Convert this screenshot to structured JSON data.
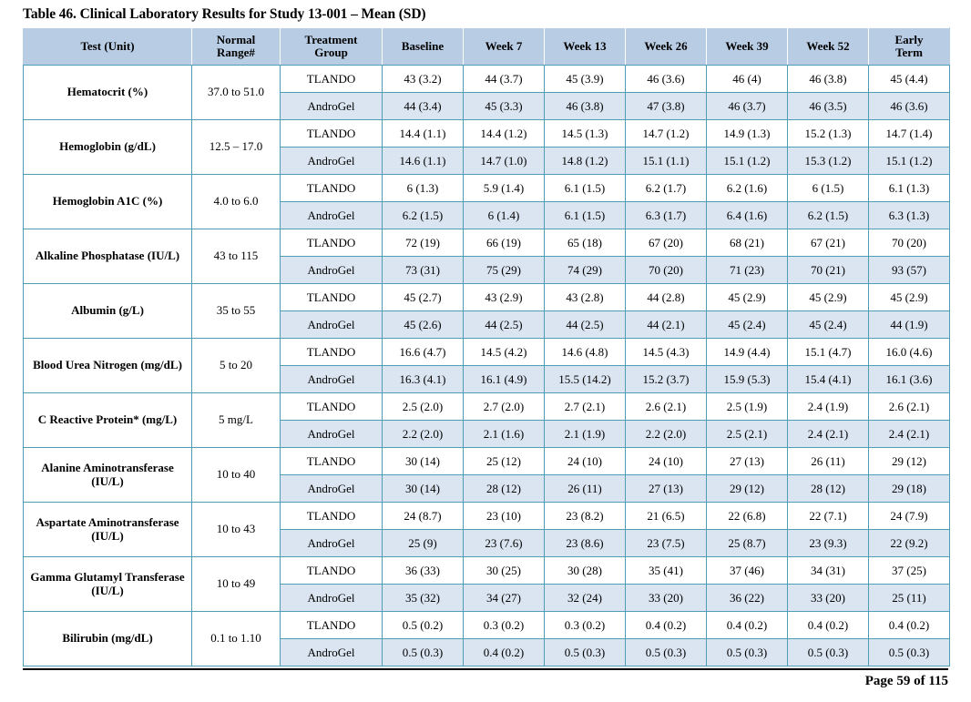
{
  "document": {
    "title": "Table 46.  Clinical Laboratory Results for Study 13-001 – Mean (SD)",
    "page_number": "Page 59 of 115"
  },
  "table": {
    "columns": [
      "Test (Unit)",
      "Normal Range#",
      "Treatment Group",
      "Baseline",
      "Week 7",
      "Week 13",
      "Week 26",
      "Week 39",
      "Week 52",
      "Early Term"
    ],
    "column_lines": [
      [
        "Test (Unit)"
      ],
      [
        "Normal",
        "Range#"
      ],
      [
        "Treatment",
        "Group"
      ],
      [
        "Baseline"
      ],
      [
        "Week 7"
      ],
      [
        "Week 13"
      ],
      [
        "Week 26"
      ],
      [
        "Week 39"
      ],
      [
        "Week 52"
      ],
      [
        "Early",
        "Term"
      ]
    ],
    "rows": [
      {
        "test": "Hematocrit (%)",
        "range": "37.0 to 51.0",
        "groups": [
          {
            "name": "TLANDO",
            "values": [
              "43 (3.2)",
              "44 (3.7)",
              "45 (3.9)",
              "46 (3.6)",
              "46 (4)",
              "46 (3.8)",
              "45 (4.4)"
            ]
          },
          {
            "name": "AndroGel",
            "values": [
              "44 (3.4)",
              "45 (3.3)",
              "46 (3.8)",
              "47 (3.8)",
              "46 (3.7)",
              "46 (3.5)",
              "46 (3.6)"
            ]
          }
        ]
      },
      {
        "test": "Hemoglobin (g/dL)",
        "range": "12.5 – 17.0",
        "groups": [
          {
            "name": "TLANDO",
            "values": [
              "14.4 (1.1)",
              "14.4 (1.2)",
              "14.5 (1.3)",
              "14.7 (1.2)",
              "14.9 (1.3)",
              "15.2 (1.3)",
              "14.7 (1.4)"
            ]
          },
          {
            "name": "AndroGel",
            "values": [
              "14.6 (1.1)",
              "14.7 (1.0)",
              "14.8 (1.2)",
              "15.1 (1.1)",
              "15.1 (1.2)",
              "15.3 (1.2)",
              "15.1 (1.2)"
            ]
          }
        ]
      },
      {
        "test": "Hemoglobin A1C (%)",
        "range": "4.0 to 6.0",
        "groups": [
          {
            "name": "TLANDO",
            "values": [
              "6 (1.3)",
              "5.9 (1.4)",
              "6.1 (1.5)",
              "6.2 (1.7)",
              "6.2 (1.6)",
              "6 (1.5)",
              "6.1 (1.3)"
            ]
          },
          {
            "name": "AndroGel",
            "values": [
              "6.2 (1.5)",
              "6 (1.4)",
              "6.1 (1.5)",
              "6.3 (1.7)",
              "6.4 (1.6)",
              "6.2 (1.5)",
              "6.3 (1.3)"
            ]
          }
        ]
      },
      {
        "test": "Alkaline Phosphatase (IU/L)",
        "range": "43 to 115",
        "groups": [
          {
            "name": "TLANDO",
            "values": [
              "72 (19)",
              "66 (19)",
              "65 (18)",
              "67 (20)",
              "68 (21)",
              "67 (21)",
              "70 (20)"
            ]
          },
          {
            "name": "AndroGel",
            "values": [
              "73 (31)",
              "75 (29)",
              "74 (29)",
              "70 (20)",
              "71 (23)",
              "70 (21)",
              "93 (57)"
            ]
          }
        ]
      },
      {
        "test": "Albumin (g/L)",
        "range": "35 to 55",
        "groups": [
          {
            "name": "TLANDO",
            "values": [
              "45 (2.7)",
              "43 (2.9)",
              "43 (2.8)",
              "44 (2.8)",
              "45 (2.9)",
              "45 (2.9)",
              "45 (2.9)"
            ]
          },
          {
            "name": "AndroGel",
            "values": [
              "45 (2.6)",
              "44 (2.5)",
              "44 (2.5)",
              "44 (2.1)",
              "45 (2.4)",
              "45 (2.4)",
              "44 (1.9)"
            ]
          }
        ]
      },
      {
        "test": "Blood Urea Nitrogen (mg/dL)",
        "range": "5 to 20",
        "groups": [
          {
            "name": "TLANDO",
            "values": [
              "16.6 (4.7)",
              "14.5 (4.2)",
              "14.6 (4.8)",
              "14.5 (4.3)",
              "14.9 (4.4)",
              "15.1 (4.7)",
              "16.0 (4.6)"
            ]
          },
          {
            "name": "AndroGel",
            "values": [
              "16.3 (4.1)",
              "16.1 (4.9)",
              "15.5 (14.2)",
              "15.2 (3.7)",
              "15.9 (5.3)",
              "15.4 (4.1)",
              "16.1 (3.6)"
            ]
          }
        ]
      },
      {
        "test": "C Reactive Protein* (mg/L)",
        "range": "5 mg/L",
        "groups": [
          {
            "name": "TLANDO",
            "values": [
              "2.5 (2.0)",
              "2.7 (2.0)",
              "2.7 (2.1)",
              "2.6 (2.1)",
              "2.5 (1.9)",
              "2.4 (1.9)",
              "2.6 (2.1)"
            ]
          },
          {
            "name": "AndroGel",
            "values": [
              "2.2 (2.0)",
              "2.1 (1.6)",
              "2.1 (1.9)",
              "2.2 (2.0)",
              "2.5 (2.1)",
              "2.4 (2.1)",
              "2.4 (2.1)"
            ]
          }
        ]
      },
      {
        "test": "Alanine Aminotransferase (IU/L)",
        "range": "10 to 40",
        "groups": [
          {
            "name": "TLANDO",
            "values": [
              "30 (14)",
              "25 (12)",
              "24 (10)",
              "24 (10)",
              "27 (13)",
              "26 (11)",
              "29 (12)"
            ]
          },
          {
            "name": "AndroGel",
            "values": [
              "30 (14)",
              "28 (12)",
              "26 (11)",
              "27 (13)",
              "29 (12)",
              "28 (12)",
              "29 (18)"
            ]
          }
        ]
      },
      {
        "test": "Aspartate Aminotransferase (IU/L)",
        "range": "10 to 43",
        "groups": [
          {
            "name": "TLANDO",
            "values": [
              "24 (8.7)",
              "23 (10)",
              "23 (8.2)",
              "21 (6.5)",
              "22 (6.8)",
              "22 (7.1)",
              "24 (7.9)"
            ]
          },
          {
            "name": "AndroGel",
            "values": [
              "25 (9)",
              "23 (7.6)",
              "23 (8.6)",
              "23 (7.5)",
              "25 (8.7)",
              "23 (9.3)",
              "22 (9.2)"
            ]
          }
        ]
      },
      {
        "test": "Gamma Glutamyl Transferase (IU/L)",
        "range": "10 to 49",
        "groups": [
          {
            "name": "TLANDO",
            "values": [
              "36 (33)",
              "30 (25)",
              "30 (28)",
              "35 (41)",
              "37 (46)",
              "34 (31)",
              "37 (25)"
            ]
          },
          {
            "name": "AndroGel",
            "values": [
              "35 (32)",
              "34 (27)",
              "32 (24)",
              "33 (20)",
              "36 (22)",
              "33 (20)",
              "25 (11)"
            ]
          }
        ]
      },
      {
        "test": "Bilirubin (mg/dL)",
        "range": "0.1 to 1.10",
        "groups": [
          {
            "name": "TLANDO",
            "values": [
              "0.5 (0.2)",
              "0.3 (0.2)",
              "0.3 (0.2)",
              "0.4 (0.2)",
              "0.4 (0.2)",
              "0.4 (0.2)",
              "0.4 (0.2)"
            ]
          },
          {
            "name": "AndroGel",
            "values": [
              "0.5 (0.3)",
              "0.4 (0.2)",
              "0.5 (0.3)",
              "0.5 (0.3)",
              "0.5 (0.3)",
              "0.5 (0.3)",
              "0.5 (0.3)"
            ]
          }
        ]
      }
    ]
  },
  "colors": {
    "header_background": "#b8cce4",
    "alt_row_background": "#dbe5f1",
    "grid_line": "#4d9eb5",
    "text": "#000000"
  }
}
